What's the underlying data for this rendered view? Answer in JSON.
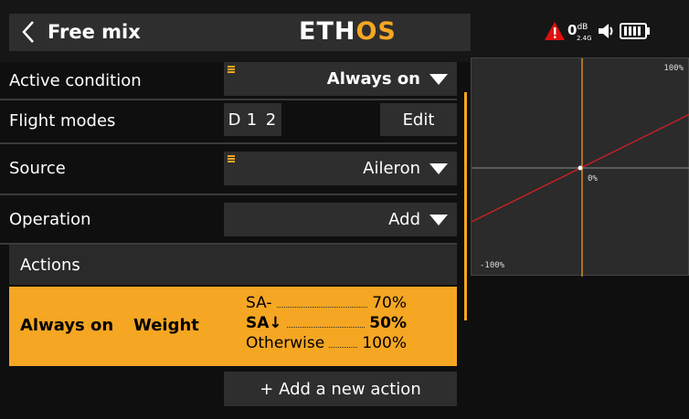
{
  "header": {
    "title": "Free mix",
    "logo_main": "ETH",
    "logo_accent": "OS",
    "rssi_value": "0",
    "rssi_unit": "dB",
    "rssi_band": "2.4G"
  },
  "fields": {
    "active_condition": {
      "label": "Active condition",
      "value": "Always on"
    },
    "flight_modes": {
      "label": "Flight modes",
      "modes": [
        "D",
        "1",
        "2"
      ],
      "edit_label": "Edit"
    },
    "source": {
      "label": "Source",
      "value": "Aileron"
    },
    "operation": {
      "label": "Operation",
      "value": "Add"
    }
  },
  "actions": {
    "header": "Actions",
    "items": [
      {
        "condition": "Always on",
        "type": "Weight",
        "lines": [
          {
            "switch": "SA-",
            "value": "70%"
          },
          {
            "switch": "SA↓",
            "value": "50%"
          },
          {
            "switch": "Otherwise",
            "value": "100%"
          }
        ]
      }
    ],
    "add_label": "+ Add a new action"
  },
  "graph": {
    "top_label": "100%",
    "center_label": "0%",
    "bottom_label": "-100%",
    "curve": {
      "x": [
        -100,
        100
      ],
      "y": [
        -50,
        50
      ]
    }
  },
  "colors": {
    "accent": "#f5a623",
    "curve": "#d02020",
    "warning": "#e01010",
    "background": "#0f0f0f",
    "field": "#2e2e2e"
  },
  "icons": [
    "back-chevron-icon",
    "warning-icon",
    "speaker-icon",
    "battery-icon",
    "dropdown-arrow-icon",
    "menu-handle-icon"
  ]
}
